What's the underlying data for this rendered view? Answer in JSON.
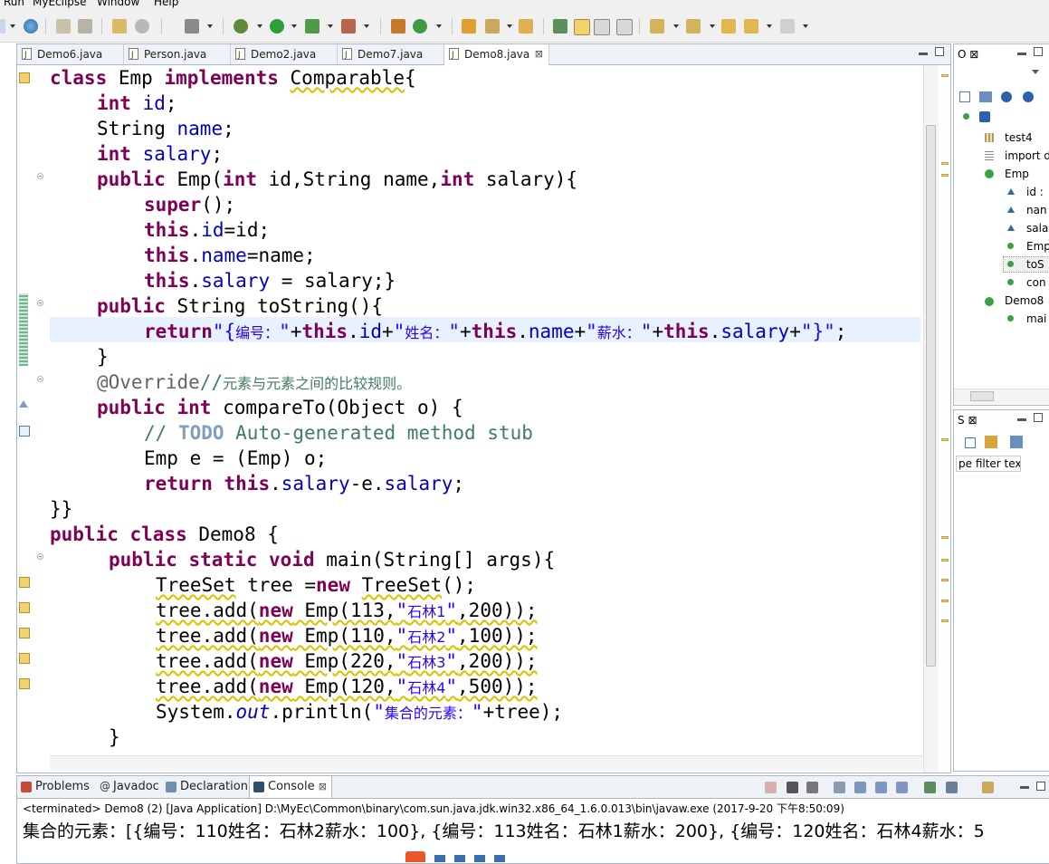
{
  "menu": [
    "Run",
    "MyEclipse",
    "Window",
    "Help"
  ],
  "editor": {
    "tabs": [
      {
        "label": "Demo6.java",
        "active": false
      },
      {
        "label": "Person.java",
        "active": false
      },
      {
        "label": "Demo2.java",
        "active": false
      },
      {
        "label": "Demo7.java",
        "active": false
      },
      {
        "label": "Demo8.java",
        "active": true
      }
    ],
    "close_glyph": "⊠",
    "code": {
      "l1": {
        "kw1": "class",
        "t1": " Emp ",
        "kw2": "implements",
        "t2": " ",
        "iface": "Comparable",
        "t3": "{"
      },
      "l2": {
        "kw": "int",
        "fld": "id",
        "end": ";"
      },
      "l3": {
        "type": "String ",
        "fld": "name",
        "end": ";"
      },
      "l4": {
        "kw": "int",
        "fld": "salary",
        "end": ";"
      },
      "l5": {
        "kw1": "public",
        "t1": " Emp(",
        "kw2": "int",
        "t2": " id,String name,",
        "kw3": "int",
        "t3": " salary){"
      },
      "l6": {
        "kw": "super",
        "t": "();"
      },
      "l7": {
        "kw": "this",
        "dot": ".",
        "fld": "id",
        "t": "=id;"
      },
      "l8": {
        "kw": "this",
        "dot": ".",
        "fld": "name",
        "t": "=name;"
      },
      "l9": {
        "kw": "this",
        "dot": ".",
        "fld": "salary",
        "t": " = salary;}"
      },
      "l10": {
        "kw": "public",
        "t": " String toString(){"
      },
      "l11": {
        "kw": "return",
        "s1": "\"{",
        "c1": "编号：",
        "s2": "\"",
        "p1": "+",
        "kw2": "this",
        "d1": ".",
        "f1": "id",
        "p2": "+",
        "s3": "\"",
        "c2": "姓名：",
        "s4": "\"",
        "p3": "+",
        "kw3": "this",
        "d2": ".",
        "f2": "name",
        "p4": "+",
        "s5": "\"",
        "c3": "薪水：",
        "s6": "\"",
        "p5": "+",
        "kw4": "this",
        "d3": ".",
        "f3": "salary",
        "p6": "+",
        "s7": "\"}\"",
        "end": ";"
      },
      "l12": "}",
      "l13": {
        "ann": "@Override",
        "cm": "//",
        "cn": "元素与元素之间的比较规则。"
      },
      "l14": {
        "kw1": "public",
        "t1": " ",
        "kw2": "int",
        "t2": " compareTo(Object o) {"
      },
      "l15": {
        "c1": "// ",
        "todo": "TODO",
        "c2": " Auto-generated method stub"
      },
      "l16": "Emp e = (Emp) o;",
      "l17": {
        "kw1": "return",
        "t1": " ",
        "kw2": "this",
        "d1": ".",
        "f1": "salary",
        "t2": "-e.",
        "f2": "salary",
        "end": ";"
      },
      "l18": "}}",
      "l19": {
        "kw1": "public",
        "t1": " ",
        "kw2": "class",
        "t2": " Demo8 {"
      },
      "l20": {
        "kw1": "public",
        "t1": " ",
        "kw2": "static",
        "t2": " ",
        "kw3": "void",
        "t3": " main(String[] args){"
      },
      "l21": {
        "a": "TreeSet",
        "b": " tree =",
        "kw": "new",
        "c": " ",
        "d": "TreeSet",
        "e": "();"
      },
      "adds": [
        {
          "a": "tree.add(",
          "kw": "new",
          "b": " Emp(113,",
          "s": "\"",
          "cn": "石林1",
          "s2": "\"",
          "c": ",200));"
        },
        {
          "a": "tree.add(",
          "kw": "new",
          "b": " Emp(110,",
          "s": "\"",
          "cn": "石林2",
          "s2": "\"",
          "c": ",100));"
        },
        {
          "a": "tree.add(",
          "kw": "new",
          "b": " Emp(220,",
          "s": "\"",
          "cn": "石林3",
          "s2": "\"",
          "c": ",200));"
        },
        {
          "a": "tree.add(",
          "kw": "new",
          "b": " Emp(120,",
          "s": "\"",
          "cn": "石林4",
          "s2": "\"",
          "c": ",500));"
        }
      ],
      "l26": {
        "a": "System.",
        "st": "out",
        "b": ".println(",
        "s": "\"",
        "cn": "集合的元素：",
        "s2": "\"",
        "c": "+tree);"
      },
      "l27": "}"
    }
  },
  "outline": {
    "tab": "O",
    "close_glyph": "⊠",
    "items": [
      "test4",
      "import d",
      "Emp",
      "id :",
      "nan",
      "sala",
      "Emp",
      "toS",
      "con",
      "Demo8",
      "mai"
    ]
  },
  "second_panel": {
    "tab": "S",
    "close_glyph": "⊠",
    "filter_placeholder": "pe filter text"
  },
  "console": {
    "tabs": [
      "Problems",
      "Javadoc",
      "Declaration",
      "Console"
    ],
    "active_tab": "Console",
    "close_glyph": "⊠",
    "status": "<terminated> Demo8 (2) [Java Application] D:\\MyEc\\Common\\binary\\com.sun.java.jdk.win32.x86_64_1.6.0.013\\bin\\javaw.exe (2017-9-20 下午8:50:09)",
    "output": "集合的元素：[{编号：110姓名：石林2薪水：100}, {编号：113姓名：石林1薪水：200}, {编号：120姓名：石林4薪水：5"
  }
}
